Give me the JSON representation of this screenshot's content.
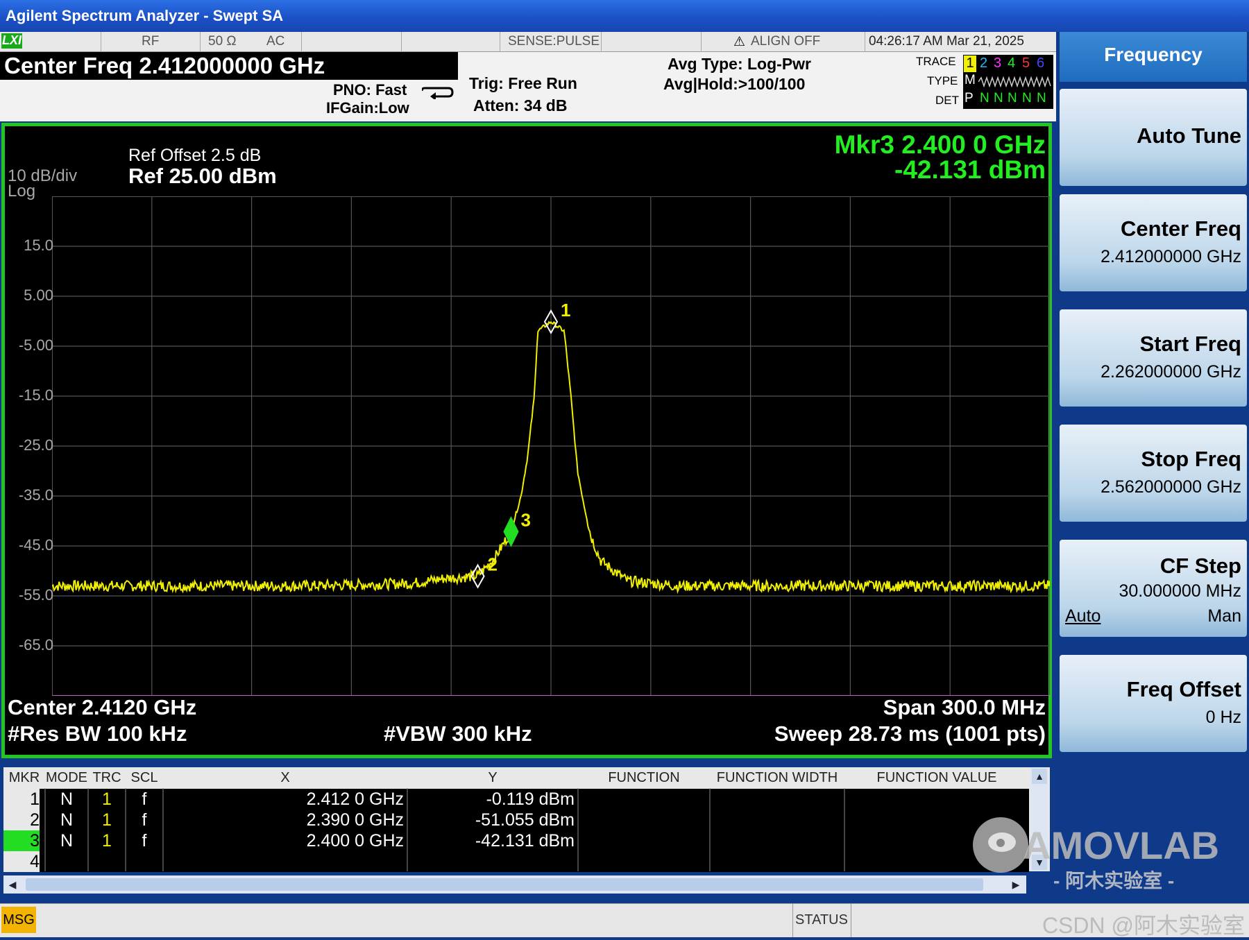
{
  "window": {
    "title": "Agilent Spectrum Analyzer - Swept SA"
  },
  "status": {
    "lxi": "LXI",
    "rf": "RF",
    "impedance": "50 Ω",
    "coupling": "AC",
    "sense": "SENSE:PULSE",
    "align": "ALIGN OFF",
    "datetime": "04:26:17 AM Mar 21, 2025"
  },
  "info": {
    "center_freq": "Center Freq 2.412000000 GHz",
    "pno": "PNO: Fast",
    "ifgain": "IFGain:Low",
    "trig": "Trig: Free Run",
    "atten": "Atten: 34 dB",
    "avg_type": "Avg Type: Log-Pwr",
    "avg_hold": "Avg|Hold:>100/100",
    "trace_label": "TRACE",
    "type_label": "TYPE",
    "det_label": "DET",
    "trace_nums": [
      "1",
      "2",
      "3",
      "4",
      "5",
      "6"
    ],
    "type_vals": "M",
    "det_vals": [
      "P",
      "N",
      "N",
      "N",
      "N",
      "N"
    ]
  },
  "screen": {
    "ref_offset": "Ref Offset 2.5 dB",
    "ref_level": "Ref 25.00 dBm",
    "scale": "10 dB/div",
    "scale_type": "Log",
    "mkr_readout_freq": "Mkr3 2.400 0 GHz",
    "mkr_readout_amp": "-42.131 dBm",
    "center": "Center 2.4120 GHz",
    "span": "Span 300.0 MHz",
    "rbw": "#Res BW 100 kHz",
    "vbw": "#VBW 300 kHz",
    "sweep": "Sweep  28.73 ms (1001 pts)",
    "y_ticks": [
      "15.0",
      "5.00",
      "-5.00",
      "-15.0",
      "-25.0",
      "-35.0",
      "-45.0",
      "-55.0",
      "-65.0"
    ],
    "marker_labels": [
      "1",
      "2",
      "3"
    ]
  },
  "chart_data": {
    "type": "line",
    "x_unit": "GHz",
    "y_unit": "dBm",
    "xlim": [
      2.262,
      2.562
    ],
    "ylim": [
      -75,
      25
    ],
    "series": [
      {
        "points": [
          [
            2.262,
            -53
          ],
          [
            2.34,
            -53
          ],
          [
            2.37,
            -52.5
          ],
          [
            2.38,
            -51.5
          ],
          [
            2.39,
            -51
          ],
          [
            2.395,
            -47.5
          ],
          [
            2.4,
            -42.1
          ],
          [
            2.403,
            -35
          ],
          [
            2.405,
            -27
          ],
          [
            2.407,
            -15
          ],
          [
            2.408,
            -2
          ],
          [
            2.412,
            -0.1
          ],
          [
            2.416,
            -2
          ],
          [
            2.418,
            -15
          ],
          [
            2.42,
            -30
          ],
          [
            2.422,
            -37
          ],
          [
            2.424,
            -43
          ],
          [
            2.427,
            -48
          ],
          [
            2.435,
            -52
          ],
          [
            2.45,
            -53
          ],
          [
            2.562,
            -53
          ]
        ]
      }
    ],
    "markers": [
      {
        "n": "1",
        "x": 2.412,
        "y": -0.119
      },
      {
        "n": "2",
        "x": 2.39,
        "y": -51.055
      },
      {
        "n": "3",
        "x": 2.4,
        "y": -42.131
      }
    ],
    "colors": {
      "trace": "#f0f000",
      "grid": "#555555",
      "active_marker": "#22dd22"
    }
  },
  "marker_table": {
    "headers": [
      "MKR",
      "MODE",
      "TRC",
      "SCL",
      "X",
      "Y",
      "FUNCTION",
      "FUNCTION WIDTH",
      "FUNCTION VALUE"
    ],
    "rows": [
      {
        "mkr": "1",
        "mode": "N",
        "trc": "1",
        "scl": "f",
        "x": "2.412 0 GHz",
        "y": "-0.119 dBm"
      },
      {
        "mkr": "2",
        "mode": "N",
        "trc": "1",
        "scl": "f",
        "x": "2.390 0 GHz",
        "y": "-51.055 dBm"
      },
      {
        "mkr": "3",
        "mode": "N",
        "trc": "1",
        "scl": "f",
        "x": "2.400 0 GHz",
        "y": "-42.131 dBm"
      },
      {
        "mkr": "4",
        "mode": "",
        "trc": "",
        "scl": "",
        "x": "",
        "y": ""
      }
    ]
  },
  "softkeys": {
    "title": "Frequency",
    "auto_tune": "Auto Tune",
    "center_freq": "Center Freq",
    "center_freq_val": "2.412000000 GHz",
    "start_freq": "Start Freq",
    "start_freq_val": "2.262000000 GHz",
    "stop_freq": "Stop Freq",
    "stop_freq_val": "2.562000000 GHz",
    "cf_step": "CF Step",
    "cf_step_val": "30.000000 MHz",
    "cf_auto": "Auto",
    "cf_man": "Man",
    "freq_offset": "Freq Offset",
    "freq_offset_val": "0 Hz"
  },
  "msg": {
    "msg": "MSG",
    "status": "STATUS"
  },
  "watermark": {
    "brand": "AMOVLAB",
    "sub": "- 阿木实验室 -",
    "csdn": "CSDN @阿木实验室"
  }
}
